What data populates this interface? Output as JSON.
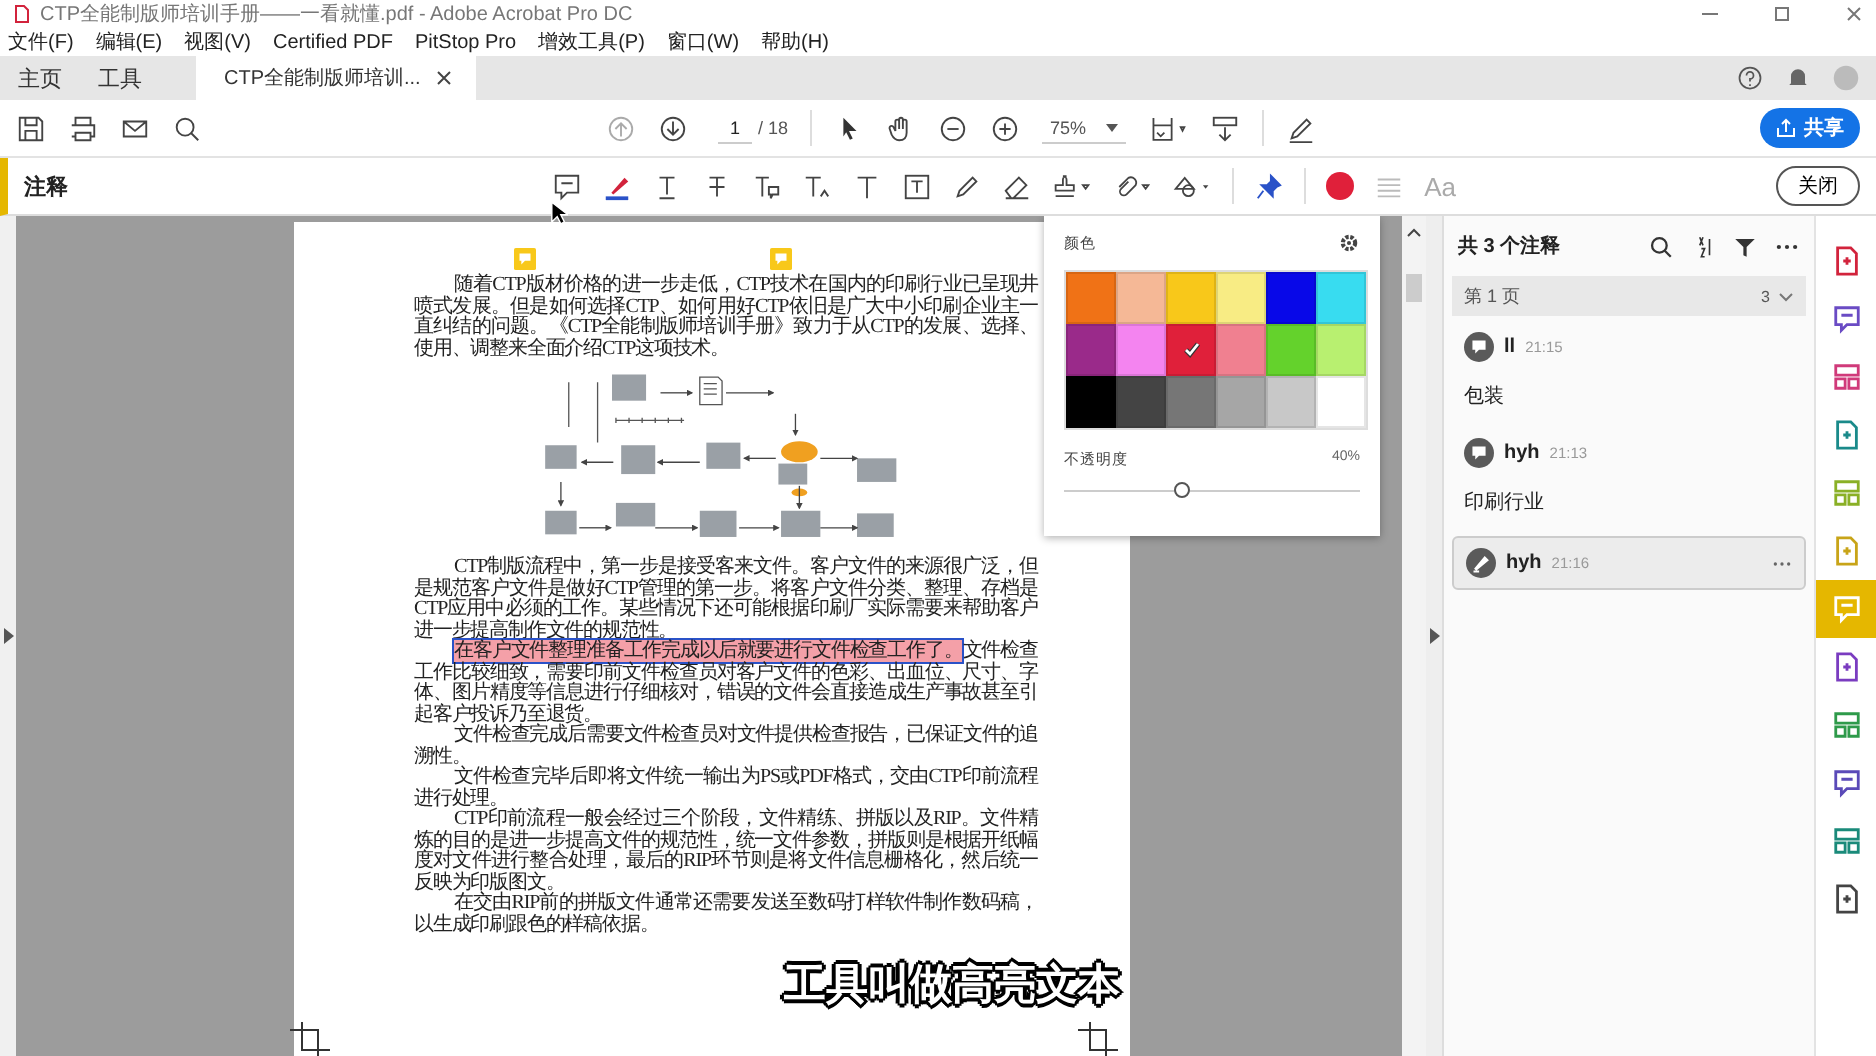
{
  "window": {
    "title": "CTP全能制版师培训手册——一看就懂.pdf - Adobe Acrobat Pro DC"
  },
  "menu": [
    "文件(F)",
    "编辑(E)",
    "视图(V)",
    "Certified PDF",
    "PitStop Pro",
    "增效工具(P)",
    "窗口(W)",
    "帮助(H)"
  ],
  "tabs": [
    {
      "label": "主页",
      "selected": false
    },
    {
      "label": "工具",
      "selected": false
    },
    {
      "label": "CTP全能制版师培训...",
      "selected": true
    }
  ],
  "toolbar": {
    "page": "1",
    "page_count": "/ 18",
    "zoom": "75%",
    "share_button": "共享"
  },
  "comment_toolbar": {
    "title": "注释",
    "color": "#e0203a",
    "font_button": "Aa",
    "close_button": "关闭"
  },
  "color_popup": {
    "title": "颜色",
    "swatches": [
      {
        "color": "#f07216",
        "selected": false
      },
      {
        "color": "#f5b896",
        "selected": false
      },
      {
        "color": "#f8c81a",
        "selected": false
      },
      {
        "color": "#f8ec84",
        "selected": false
      },
      {
        "color": "#0808e8",
        "selected": false
      },
      {
        "color": "#38dcf0",
        "selected": false
      },
      {
        "color": "#9a2a8a",
        "selected": false
      },
      {
        "color": "#f484f0",
        "selected": false
      },
      {
        "color": "#e0203a",
        "selected": true
      },
      {
        "color": "#f08090",
        "selected": false
      },
      {
        "color": "#64d22c",
        "selected": false
      },
      {
        "color": "#b8f070",
        "selected": false
      },
      {
        "color": "#000000",
        "selected": false
      },
      {
        "color": "#444444",
        "selected": false
      },
      {
        "color": "#767676",
        "selected": false
      },
      {
        "color": "#a6a6a6",
        "selected": false
      },
      {
        "color": "#c8c8c8",
        "selected": false
      },
      {
        "color": "#ffffff",
        "selected": false
      }
    ],
    "opacity": {
      "label": "不透明度",
      "reading": "40%",
      "level": 0.4
    }
  },
  "document": {
    "paragraphs": [
      {
        "text": "随着CTP版材价格的进一步走低，CTP技术在国内的印刷行业已呈现井喷式发展。但是如何选择CTP、如何用好CTP依旧是广大中小印刷企业主一直纠结的问题。《CTP全能制版师培训手册》致力于从CTP的发展、选择、使用、调整来全面介绍CTP这项技术。"
      },
      {
        "text": "CTP制版流程中，第一步是接受客来文件。客户文件的来源很广泛，但是规范客户文件是做好CTP管理的第一步。将客户文件分类、整理、存档是CTP应用中必须的工作。某些情况下还可能根据印刷厂实际需要来帮助客户进一步提高制作文件的规范性。"
      },
      {
        "highlight": "在客户文件整理准备工作完成以后就要进行文件检查工作了。",
        "text": "文件检查工作比较细致，需要印前文件检查员对客户文件的色彩、出血位、尺寸、字体、图片精度等信息进行仔细核对，错误的文件会直接造成生产事故甚至引起客户投诉乃至退货。"
      },
      {
        "text": "文件检查完成后需要文件检查员对文件提供检查报告，已保证文件的追溯性。"
      },
      {
        "text": "文件检查完毕后即将文件统一输出为PS或PDF格式，交由CTP印前流程进行处理。"
      },
      {
        "text": "CTP印前流程一般会经过三个阶段，文件精练、拼版以及RIP。文件精炼的目的是进一步提高文件的规范性，统一文件参数，拼版则是根据开纸幅度对文件进行整合处理，最后的RIP环节则是将文件信息栅格化，然后统一反映为印版图文。"
      },
      {
        "text": "在交由RIP前的拼版文件通常还需要发送至数码打样软件制作数码稿，以生成印刷跟色的样稿依据。"
      }
    ]
  },
  "comments_panel": {
    "title": "共 3 个注释",
    "group": {
      "label": "第 1 页",
      "count": "3"
    },
    "comments": [
      {
        "kind": "note",
        "author": "ll",
        "time": "21:15",
        "text": "包装",
        "selected": false
      },
      {
        "kind": "note",
        "author": "hyh",
        "time": "21:13",
        "text": "印刷行业",
        "selected": false
      },
      {
        "kind": "highlight",
        "author": "hyh",
        "time": "21:16",
        "selected": true
      }
    ]
  },
  "tool_rail": [
    {
      "selected": false
    },
    {
      "selected": false
    },
    {
      "selected": false
    },
    {
      "selected": false
    },
    {
      "selected": false
    },
    {
      "selected": false
    },
    {
      "selected": true
    },
    {
      "selected": false
    },
    {
      "selected": false
    },
    {
      "selected": false
    },
    {
      "selected": false
    },
    {
      "selected": false
    }
  ],
  "subtitle": "工具叫做高亮文本"
}
